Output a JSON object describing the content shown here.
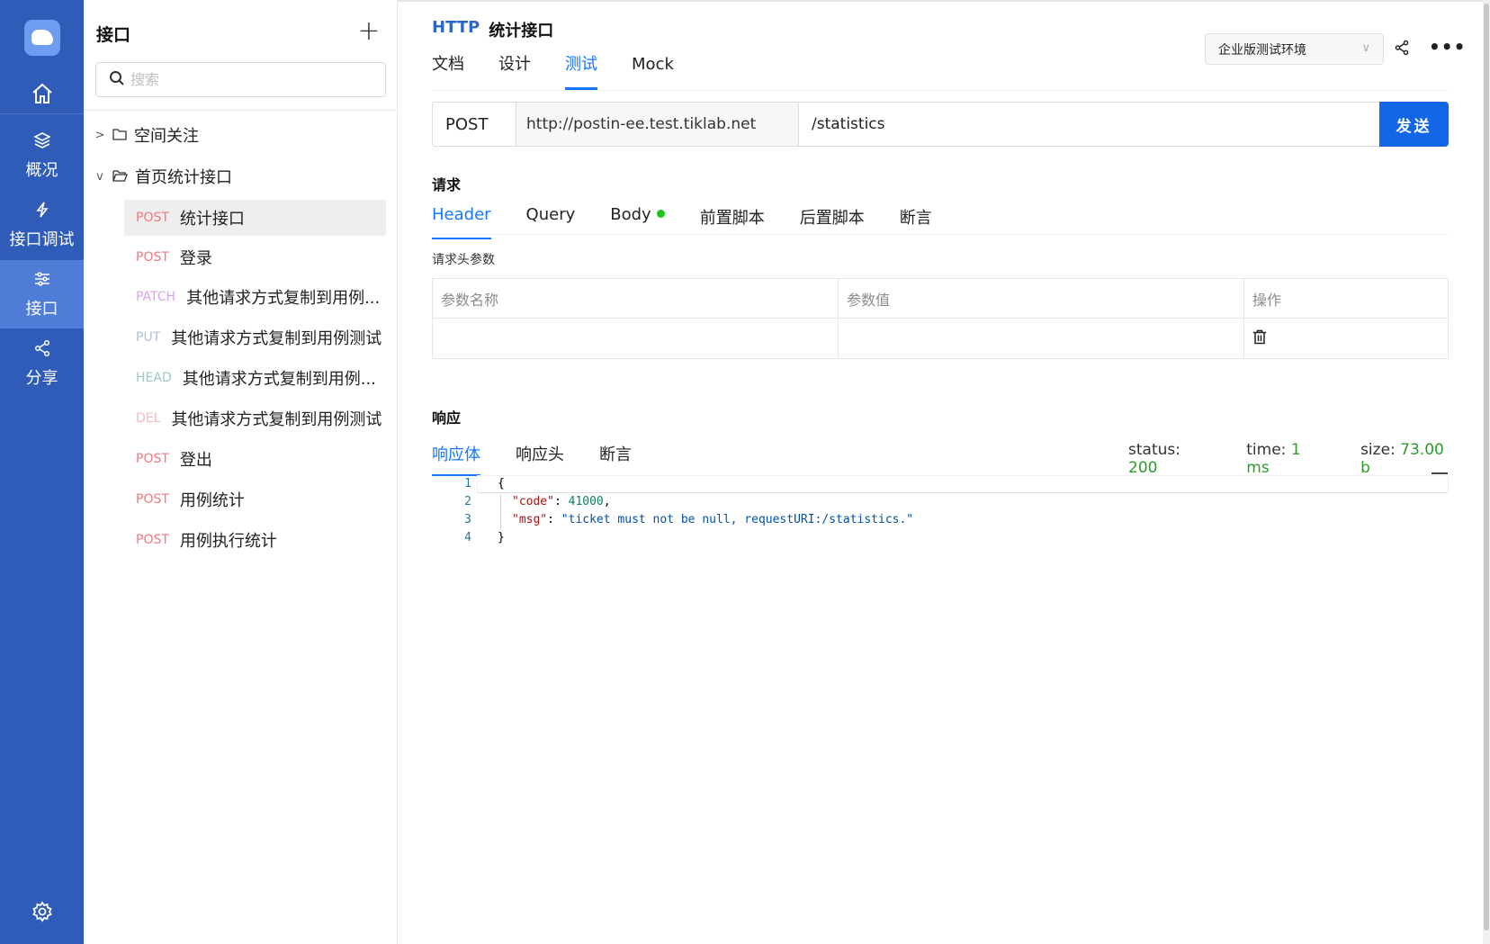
{
  "nav": {
    "items": [
      {
        "label": "概况",
        "icon": "layers-icon"
      },
      {
        "label": "接口调试",
        "icon": "lightning-icon"
      },
      {
        "label": "接口",
        "icon": "sliders-icon",
        "active": true
      },
      {
        "label": "分享",
        "icon": "share-icon"
      }
    ],
    "accent": "#2f5cb8"
  },
  "tree": {
    "title": "接口",
    "search_placeholder": "搜索",
    "folders": [
      {
        "label": "空间关注",
        "expanded": false
      },
      {
        "label": "首页统计接口",
        "expanded": true
      }
    ],
    "apis": [
      {
        "method": "POST",
        "name": "统计接口",
        "active": true
      },
      {
        "method": "POST",
        "name": "登录"
      },
      {
        "method": "PATCH",
        "name": "其他请求方式复制到用例..."
      },
      {
        "method": "PUT",
        "name": "其他请求方式复制到用例测试"
      },
      {
        "method": "HEAD",
        "name": "其他请求方式复制到用例..."
      },
      {
        "method": "DEL",
        "name": "其他请求方式复制到用例测试"
      },
      {
        "method": "POST",
        "name": "登出"
      },
      {
        "method": "POST",
        "name": "用例统计"
      },
      {
        "method": "POST",
        "name": "用例执行统计"
      }
    ]
  },
  "header": {
    "protocol": "HTTP",
    "name": "统计接口",
    "tabs": [
      "文档",
      "设计",
      "测试",
      "Mock"
    ],
    "active_tab": "测试",
    "env": "企业版测试环境"
  },
  "request": {
    "method": "POST",
    "base_url": "http://postin-ee.test.tiklab.net",
    "path": "/statistics",
    "send_label": "发送",
    "section_title": "请求",
    "tabs": [
      "Header",
      "Query",
      "Body",
      "前置脚本",
      "后置脚本",
      "断言"
    ],
    "header_params_title": "请求头参数",
    "table_headers": [
      "参数名称",
      "参数值",
      "操作"
    ]
  },
  "response": {
    "section_title": "响应",
    "tabs": [
      "响应体",
      "响应头",
      "断言"
    ],
    "status_label": "status:",
    "status_value": "200",
    "time_label": "time:",
    "time_value": "1 ms",
    "size_label": "size:",
    "size_value": "73.00 b",
    "line_numbers": [
      "1",
      "2",
      "3",
      "4"
    ],
    "code_lines": {
      "l1": "{",
      "code_key": "\"code\"",
      "code_value": "41000",
      "msg_key": "\"msg\"",
      "msg_value": "\"ticket must not be null, requestURI:/statistics.\"",
      "l4": "}"
    }
  }
}
